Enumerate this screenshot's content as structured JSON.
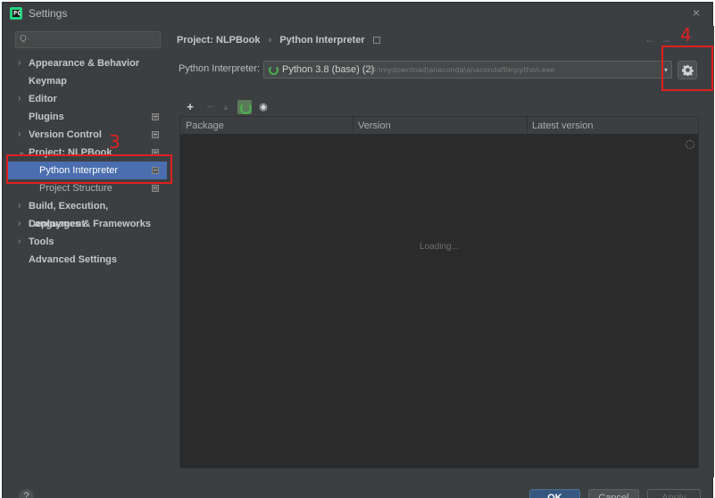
{
  "window": {
    "title": "Settings",
    "close_glyph": "×"
  },
  "search": {
    "placeholder": "Q·"
  },
  "sidebar": {
    "items": [
      {
        "label": "Appearance & Behavior",
        "chevron": "›",
        "badge": false
      },
      {
        "label": "Keymap",
        "chevron": "",
        "badge": false
      },
      {
        "label": "Editor",
        "chevron": "›",
        "badge": false
      },
      {
        "label": "Plugins",
        "chevron": "",
        "badge": true
      },
      {
        "label": "Version Control",
        "chevron": "›",
        "badge": true
      },
      {
        "label": "Project: NLPBook",
        "chevron": "⌄",
        "badge": true
      },
      {
        "label": "Python Interpreter",
        "chevron": "",
        "badge": true,
        "selected": true
      },
      {
        "label": "Project Structure",
        "chevron": "",
        "badge": true
      },
      {
        "label": "Build, Execution, Deployment",
        "chevron": "›",
        "badge": false
      },
      {
        "label": "Languages & Frameworks",
        "chevron": "›",
        "badge": false
      },
      {
        "label": "Tools",
        "chevron": "›",
        "badge": false
      },
      {
        "label": "Advanced Settings",
        "chevron": "",
        "badge": false
      }
    ]
  },
  "breadcrumb": {
    "project": "Project: NLPBook",
    "separator": "›",
    "page": "Python Interpreter"
  },
  "nav_arrows": "←→",
  "interpreter": {
    "label": "Python Interpreter:",
    "name": "Python 3.8 (base) (2)",
    "path": "D:\\mydownload\\anaconda\\anacondafile\\python.exe",
    "arrow": "▾"
  },
  "toolbar": {
    "add": "+",
    "remove": "−",
    "up": "▲",
    "eye": "◉"
  },
  "table": {
    "columns": [
      "Package",
      "Version",
      "Latest version"
    ],
    "loading_text": "Loading..."
  },
  "footer": {
    "help": "?",
    "ok": "OK",
    "cancel": "Cancel",
    "apply": "Apply"
  },
  "annotations": {
    "step3": "3",
    "step4": "4",
    "color": "#e02020"
  },
  "colors": {
    "selection": "#4b6eaf",
    "panel": "#3c3f41",
    "table_bg": "#2b2b2b",
    "accent_green": "#4caf50"
  }
}
